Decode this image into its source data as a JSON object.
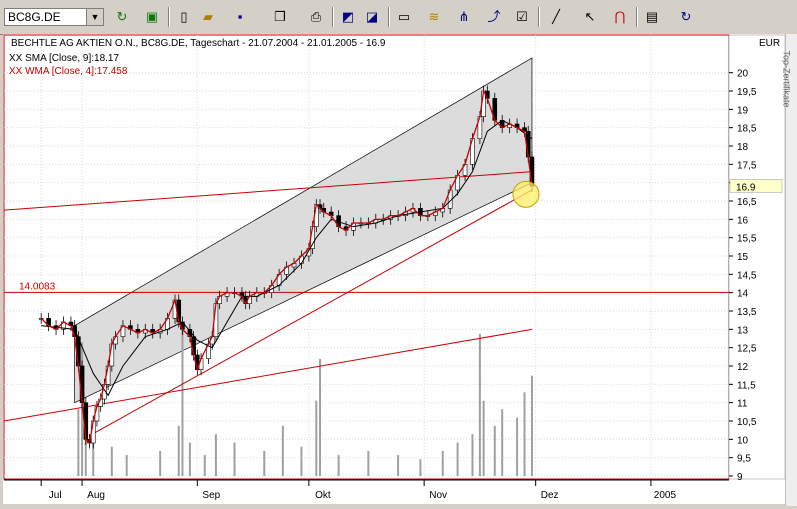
{
  "toolbar": {
    "symbol": "BC8G.DE",
    "icons": [
      "refresh-icon",
      "recalc-icon",
      "new-icon",
      "open-icon",
      "save-icon",
      "copy-icon",
      "print-icon",
      "chart-window-icon",
      "chart-window2-icon",
      "bar-type-icon",
      "indicator-icon",
      "drawing-icon",
      "trend-icon",
      "settings-icon",
      "line-tool-icon",
      "cursor-icon",
      "magnet-icon",
      "properties-icon",
      "redo-icon"
    ]
  },
  "side_label": "Top-Zertifikate",
  "chart_data": {
    "type": "candlestick",
    "title": "BECHTLE AG AKTIEN O.N., BC8G.DE, Tageschart - 21.07.2004 - 21.01.2005 - 16.9",
    "currency": "EUR",
    "last_price": "16.9",
    "legend": [
      {
        "name": "XX SMA [Close, 9]:18.17",
        "color": "#000000"
      },
      {
        "name": "XX WMA [Close, 4]:17.458",
        "color": "#cc0000"
      }
    ],
    "horizontal_line": {
      "label": "14.0083",
      "value": 14.0083,
      "color": "#cc0000"
    },
    "ylim": [
      9.0,
      20.4
    ],
    "y_ticks": [
      "9",
      "9,5",
      "10",
      "10,5",
      "11",
      "11,5",
      "12",
      "12,5",
      "13",
      "13,5",
      "14",
      "14,5",
      "15",
      "15,5",
      "16",
      "16,5",
      "17",
      "17,5",
      "18",
      "18,5",
      "19",
      "19,5",
      "20"
    ],
    "x_labels": [
      {
        "label": "Jul",
        "day": 0
      },
      {
        "label": "Aug",
        "day": 11
      },
      {
        "label": "Sep",
        "day": 42
      },
      {
        "label": "Okt",
        "day": 72
      },
      {
        "label": "Nov",
        "day": 103
      },
      {
        "label": "Dez",
        "day": 133
      },
      {
        "label": "2005",
        "day": 164
      }
    ],
    "x_range_days": [
      -10,
      185
    ],
    "series_close": [
      [
        0,
        13.3
      ],
      [
        2,
        13.1
      ],
      [
        4,
        13.0
      ],
      [
        6,
        13.2
      ],
      [
        8,
        13.1
      ],
      [
        9,
        12.8
      ],
      [
        10,
        12.0
      ],
      [
        11,
        11.0
      ],
      [
        12,
        10.0
      ],
      [
        13,
        9.9
      ],
      [
        14,
        10.5
      ],
      [
        15,
        10.9
      ],
      [
        16,
        11.1
      ],
      [
        17,
        11.5
      ],
      [
        18,
        12.0
      ],
      [
        19,
        12.6
      ],
      [
        20,
        12.8
      ],
      [
        22,
        13.1
      ],
      [
        24,
        13.0
      ],
      [
        26,
        12.9
      ],
      [
        28,
        13.0
      ],
      [
        30,
        12.9
      ],
      [
        32,
        13.0
      ],
      [
        34,
        13.3
      ],
      [
        36,
        13.8
      ],
      [
        37,
        13.2
      ],
      [
        38,
        13.0
      ],
      [
        40,
        12.8
      ],
      [
        41,
        12.3
      ],
      [
        42,
        11.9
      ],
      [
        43,
        12.2
      ],
      [
        45,
        12.6
      ],
      [
        46,
        12.8
      ],
      [
        47,
        13.7
      ],
      [
        48,
        13.9
      ],
      [
        50,
        14.0
      ],
      [
        52,
        14.0
      ],
      [
        54,
        13.9
      ],
      [
        55,
        13.7
      ],
      [
        56,
        13.9
      ],
      [
        58,
        14.0
      ],
      [
        60,
        14.0
      ],
      [
        62,
        14.2
      ],
      [
        64,
        14.5
      ],
      [
        66,
        14.7
      ],
      [
        68,
        14.8
      ],
      [
        70,
        15.0
      ],
      [
        72,
        15.2
      ],
      [
        73,
        15.8
      ],
      [
        74,
        16.4
      ],
      [
        75,
        16.3
      ],
      [
        76,
        16.2
      ],
      [
        78,
        16.1
      ],
      [
        80,
        15.8
      ],
      [
        82,
        15.7
      ],
      [
        84,
        15.9
      ],
      [
        86,
        15.9
      ],
      [
        88,
        15.9
      ],
      [
        90,
        16.0
      ],
      [
        92,
        16.0
      ],
      [
        94,
        16.1
      ],
      [
        96,
        16.1
      ],
      [
        98,
        16.2
      ],
      [
        100,
        16.3
      ],
      [
        102,
        16.1
      ],
      [
        104,
        16.1
      ],
      [
        106,
        16.2
      ],
      [
        108,
        16.3
      ],
      [
        110,
        16.8
      ],
      [
        112,
        17.2
      ],
      [
        114,
        17.5
      ],
      [
        116,
        18.2
      ],
      [
        118,
        18.8
      ],
      [
        119,
        19.5
      ],
      [
        120,
        19.3
      ],
      [
        122,
        18.7
      ],
      [
        124,
        18.5
      ],
      [
        126,
        18.6
      ],
      [
        128,
        18.5
      ],
      [
        130,
        18.4
      ],
      [
        131,
        17.7
      ],
      [
        132,
        16.9
      ]
    ],
    "series_sma": [
      [
        0,
        13.1
      ],
      [
        9,
        13.0
      ],
      [
        14,
        11.8
      ],
      [
        18,
        11.2
      ],
      [
        22,
        12.0
      ],
      [
        28,
        12.8
      ],
      [
        34,
        13.0
      ],
      [
        38,
        13.2
      ],
      [
        42,
        12.7
      ],
      [
        46,
        12.5
      ],
      [
        50,
        13.2
      ],
      [
        54,
        13.9
      ],
      [
        58,
        13.9
      ],
      [
        64,
        14.2
      ],
      [
        70,
        14.8
      ],
      [
        74,
        15.5
      ],
      [
        78,
        16.0
      ],
      [
        84,
        15.8
      ],
      [
        90,
        15.9
      ],
      [
        96,
        16.1
      ],
      [
        102,
        16.2
      ],
      [
        108,
        16.3
      ],
      [
        112,
        16.7
      ],
      [
        116,
        17.3
      ],
      [
        120,
        18.4
      ],
      [
        124,
        18.7
      ],
      [
        128,
        18.5
      ],
      [
        132,
        18.2
      ]
    ],
    "volume": [
      [
        10,
        0.16
      ],
      [
        11,
        0.32
      ],
      [
        12,
        0.12
      ],
      [
        14,
        0.08
      ],
      [
        19,
        0.07
      ],
      [
        23,
        0.05
      ],
      [
        32,
        0.06
      ],
      [
        37,
        0.12
      ],
      [
        38,
        0.36
      ],
      [
        40,
        0.08
      ],
      [
        44,
        0.05
      ],
      [
        47,
        0.1
      ],
      [
        52,
        0.08
      ],
      [
        60,
        0.06
      ],
      [
        65,
        0.12
      ],
      [
        70,
        0.07
      ],
      [
        74,
        0.18
      ],
      [
        75,
        0.28
      ],
      [
        80,
        0.05
      ],
      [
        88,
        0.06
      ],
      [
        96,
        0.05
      ],
      [
        102,
        0.04
      ],
      [
        108,
        0.06
      ],
      [
        112,
        0.08
      ],
      [
        116,
        0.1
      ],
      [
        118,
        0.34
      ],
      [
        119,
        0.18
      ],
      [
        122,
        0.12
      ],
      [
        124,
        0.16
      ],
      [
        128,
        0.14
      ],
      [
        130,
        0.2
      ],
      [
        132,
        0.24
      ]
    ],
    "channel": {
      "upper": [
        [
          9,
          13.1
        ],
        [
          132,
          20.4
        ]
      ],
      "lower_right": [
        [
          132,
          17.0
        ]
      ],
      "lower": [
        [
          9,
          11.0
        ],
        [
          132,
          17.0
        ]
      ]
    },
    "trend_lines": [
      [
        [
          -10,
          16.25
        ],
        [
          132,
          17.3
        ]
      ],
      [
        [
          -10,
          10.5
        ],
        [
          132,
          13.0
        ]
      ],
      [
        [
          13,
          10.1
        ],
        [
          132,
          16.8
        ]
      ]
    ]
  }
}
